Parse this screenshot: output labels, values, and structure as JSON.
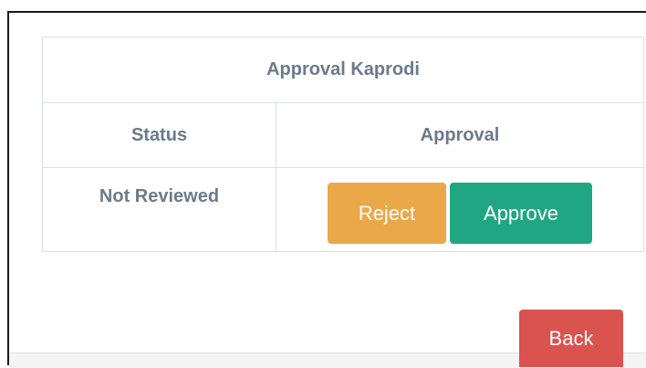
{
  "panel": {
    "title": "Approval Kaprodi",
    "columns": {
      "status": "Status",
      "approval": "Approval"
    },
    "row": {
      "status": "Not Reviewed",
      "reject_label": "Reject",
      "approve_label": "Approve"
    }
  },
  "footer": {
    "back_label": "Back"
  },
  "colors": {
    "reject": "#eba849",
    "approve": "#20a683",
    "back": "#d9534f",
    "text": "#6c7a8c"
  }
}
